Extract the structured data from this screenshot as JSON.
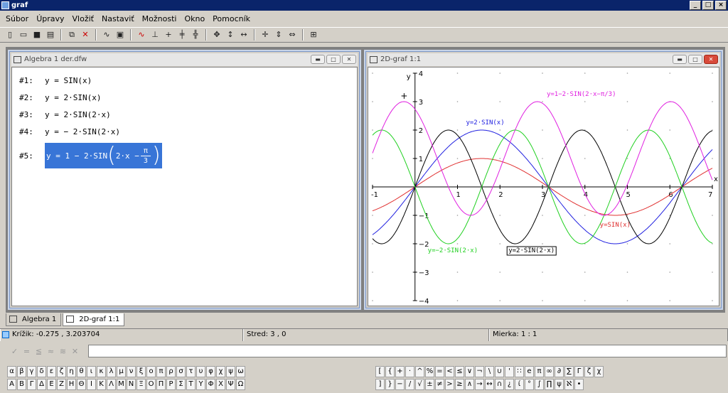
{
  "app": {
    "title": "graf"
  },
  "menu": [
    "Súbor",
    "Úpravy",
    "Vložiť",
    "Nastaviť",
    "Možnosti",
    "Okno",
    "Pomocník"
  ],
  "algebra": {
    "title": "Algebra 1  der.dfw",
    "exprs": [
      {
        "num": "#1:",
        "text": "y = SIN(x)"
      },
      {
        "num": "#2:",
        "text": "y = 2·SIN(x)"
      },
      {
        "num": "#3:",
        "text": "y = 2·SIN(2·x)"
      },
      {
        "num": "#4:",
        "text": "y = − 2·SIN(2·x)"
      }
    ],
    "expr5": {
      "num": "#5:",
      "pre": "y = 1 − 2·SIN",
      "inner": "2·x − ",
      "numer": "π",
      "denom": "3"
    }
  },
  "graph": {
    "title": "2D-graf 1:1",
    "xlabel": "x",
    "ylabel": "y",
    "cursor": "+",
    "labels": {
      "f1": "y=SIN(x)",
      "f2": "y=2·SIN(x)",
      "f3": "y=−2·SIN(2·x)",
      "f4": "y=2·SIN(2·x)",
      "f5": "y=1−2·SIN(2·x−π/3)"
    }
  },
  "chart_data": {
    "type": "line",
    "xlim": [
      -1,
      7
    ],
    "ylim": [
      -4,
      4
    ],
    "grid": true,
    "x_ticks": [
      "-1",
      "1",
      "2",
      "3",
      "4",
      "5",
      "6",
      "7"
    ],
    "y_ticks": [
      "4",
      "3",
      "2",
      "1",
      "−1",
      "−2",
      "−3",
      "−4"
    ],
    "series": [
      {
        "name": "y=SIN(x)",
        "color": "#e03030",
        "expr": "sin(x)"
      },
      {
        "name": "y=2·SIN(x)",
        "color": "#2020e0",
        "expr": "2*sin(x)"
      },
      {
        "name": "y=2·SIN(2·x)",
        "color": "#000000",
        "expr": "2*sin(2*x)"
      },
      {
        "name": "y=−2·SIN(2·x)",
        "color": "#20d020",
        "expr": "-2*sin(2*x)"
      },
      {
        "name": "y=1−2·SIN(2·x−π/3)",
        "color": "#e020e0",
        "expr": "1-2*sin(2*x-pi/3)"
      }
    ]
  },
  "tabs": [
    "Algebra 1",
    "2D-graf 1:1"
  ],
  "status": {
    "cross": "Krížik: -0.275 , 3.203704",
    "center": "Stred: 3 , 0",
    "scale": "Mierka: 1 : 1"
  },
  "greek1": [
    "α",
    "β",
    "γ",
    "δ",
    "ε",
    "ζ",
    "η",
    "θ",
    "ι",
    "κ",
    "λ",
    "μ",
    "ν",
    "ξ",
    "ο",
    "π",
    "ρ",
    "σ",
    "τ",
    "υ",
    "φ",
    "χ",
    "ψ",
    "ω"
  ],
  "greek2": [
    "Α",
    "Β",
    "Γ",
    "Δ",
    "Ε",
    "Ζ",
    "Η",
    "Θ",
    "Ι",
    "Κ",
    "Λ",
    "Μ",
    "Ν",
    "Ξ",
    "Ο",
    "Π",
    "Ρ",
    "Σ",
    "Τ",
    "Υ",
    "Φ",
    "Χ",
    "Ψ",
    "Ω"
  ],
  "ops1": [
    "[",
    "{",
    "+",
    "·",
    "^",
    "%",
    "=",
    "<",
    "≤",
    "∨",
    "¬",
    "\\",
    "∪",
    "'",
    "∷",
    "e",
    "π",
    "∞",
    "∂",
    "∑",
    "Γ",
    "ζ",
    "χ"
  ],
  "ops2": [
    "]",
    "}",
    "−",
    "/",
    "√",
    "±",
    "≠",
    ">",
    "≥",
    "∧",
    "→",
    "↔",
    "∩",
    "¿",
    "ί",
    "°",
    "∫",
    "∏",
    "ψ",
    "ℵ",
    "•"
  ]
}
